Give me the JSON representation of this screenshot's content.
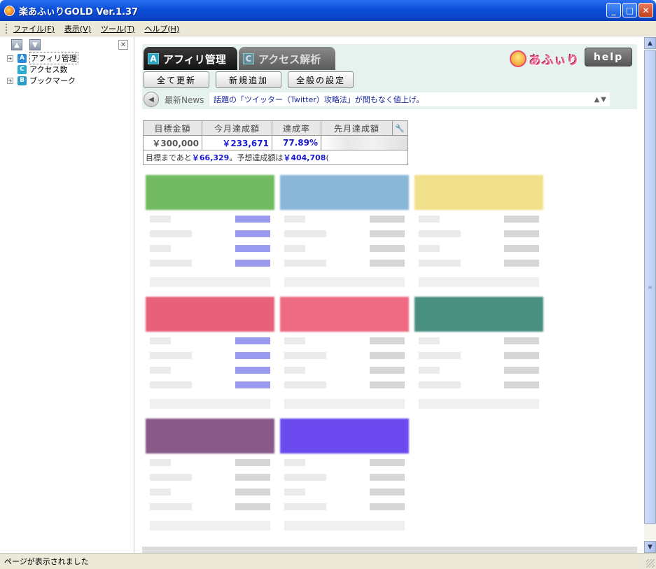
{
  "window": {
    "title": "楽あふぃりGOLD Ver.1.37"
  },
  "menu": [
    "ファイル(F)",
    "表示(V)",
    "ツール(T)",
    "ヘルプ(H)"
  ],
  "tree": {
    "items": [
      {
        "label": "アフィリ管理",
        "icon_letter": "A",
        "icon_color": "#2a8ad8",
        "expandable": true,
        "selected": true
      },
      {
        "label": "アクセス数",
        "icon_letter": "C",
        "icon_color": "#2aaad0",
        "expandable": false,
        "selected": false
      },
      {
        "label": "ブックマーク",
        "icon_letter": "B",
        "icon_color": "#2a9ac8",
        "expandable": true,
        "selected": false
      }
    ]
  },
  "tabs": {
    "active": {
      "letter": "A",
      "label": "アフィリ管理"
    },
    "inactive": {
      "letter": "C",
      "label": "アクセス解析"
    }
  },
  "logo_text": "あふぃり",
  "help_label": "help",
  "actions": {
    "refresh_all": "全て更新",
    "add_new": "新規追加",
    "settings": "全般の設定"
  },
  "news": {
    "label": "最新News",
    "text": "話題の「ツイッター（Twitter）攻略法」が間もなく値上げ。",
    "arrows": "▲▼"
  },
  "summary": {
    "headers": [
      "目標金額",
      "今月達成額",
      "達成率",
      "先月達成額"
    ],
    "target": "￥300,000",
    "this_month": "￥233,671",
    "rate": "77.89%",
    "remain_prefix": "目標まであと",
    "remain_value": "￥66,329",
    "forecast_prefix": "。予想達成額は",
    "forecast_value": "￥404,708",
    "forecast_suffix": "("
  },
  "cards": [
    {
      "color": "#72bb62",
      "accent_rows": true
    },
    {
      "color": "#8ab6d8",
      "accent_rows": false
    },
    {
      "color": "#f0e08a",
      "accent_rows": false
    },
    {
      "color": "#e8607a",
      "accent_rows": true
    },
    {
      "color": "#ee6a82",
      "accent_rows": false
    },
    {
      "color": "#4a9080",
      "accent_rows": false
    },
    {
      "color": "#8a5a8a",
      "accent_rows": false
    },
    {
      "color": "#6a4aee",
      "accent_rows": false
    }
  ],
  "status": {
    "text": "ページが表示されました"
  },
  "colors": {
    "accent_blue": "#1a1ad0",
    "panel_bg": "#e6f2ee",
    "chrome": "#ece9d8"
  }
}
